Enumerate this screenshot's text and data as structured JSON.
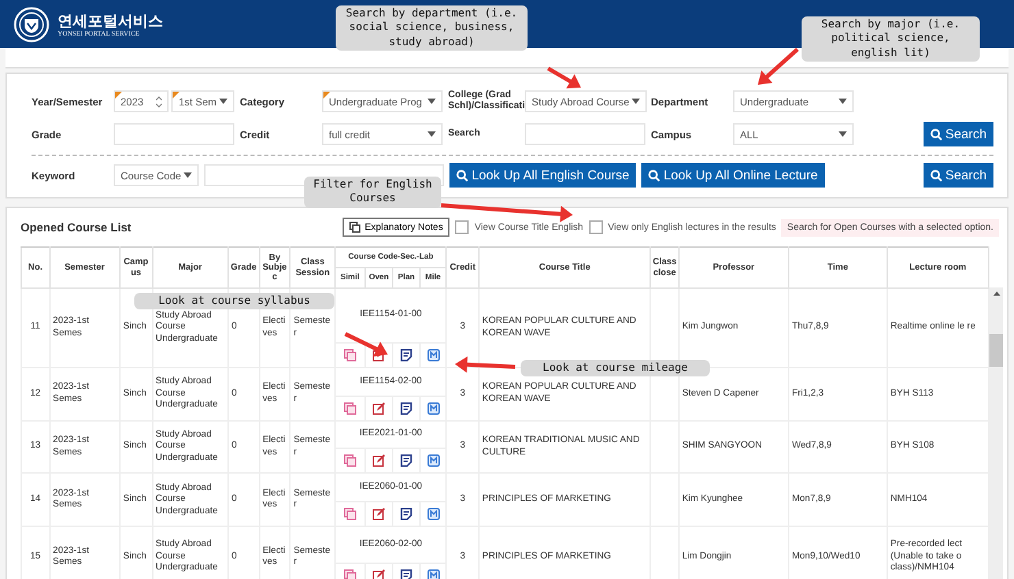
{
  "header": {
    "title": "연세포털서비스",
    "subtitle": "YONSEI PORTAL SERVICE"
  },
  "search_form": {
    "rows": [
      [
        {
          "label": "Year/Semester",
          "fields": [
            {
              "kind": "spinner",
              "value": "2023",
              "required": true
            },
            {
              "kind": "select",
              "value": "1st Sem",
              "required": true
            }
          ]
        },
        {
          "label": "Category",
          "fields": [
            {
              "kind": "select",
              "value": "Undergraduate Prog",
              "required": true
            }
          ]
        },
        {
          "label": "College (Grad Schl)/Classificati",
          "fields": [
            {
              "kind": "select",
              "value": "Study Abroad Course",
              "required": false
            }
          ]
        },
        {
          "label": "Department",
          "fields": [
            {
              "kind": "select",
              "value": "Undergraduate",
              "required": false
            }
          ]
        }
      ],
      [
        {
          "label": "Grade",
          "fields": [
            {
              "kind": "input"
            }
          ]
        },
        {
          "label": "Credit",
          "fields": [
            {
              "kind": "select",
              "value": "full credit",
              "required": false
            }
          ]
        },
        {
          "label": "Search",
          "fields": [
            {
              "kind": "input"
            }
          ]
        },
        {
          "label": "Campus",
          "fields": [
            {
              "kind": "select",
              "value": "ALL",
              "required": false
            }
          ]
        }
      ]
    ],
    "search_button": "Search",
    "keyword": {
      "label": "Keyword",
      "type_select": "Course Code"
    },
    "keyword_buttons": [
      "Look Up All English Course",
      "Look Up All Online Lecture",
      "Search"
    ]
  },
  "results": {
    "title": "Opened Course List",
    "notes_button": "Explanatory Notes",
    "options": [
      {
        "label": "View Course Title English",
        "checked": false
      },
      {
        "label": "View only English lectures in the results",
        "checked": false
      }
    ],
    "notice": "Search for Open Courses with a selected option.",
    "columns": [
      "No.",
      "Semester",
      "Campus",
      "Major",
      "Grade",
      "By Subjec",
      "Class Session",
      "Course Code-Sec.-Lab",
      "Credit",
      "Course Title",
      "Class close",
      "Professor",
      "Time",
      "Lecture room"
    ],
    "code_subcolumns": [
      "Simil",
      "Oven",
      "Plan",
      "Mile"
    ],
    "rows": [
      {
        "no": "11",
        "semester": "2023-1st Semes",
        "campus": "Sinch",
        "major": "Study Abroad Course Undergraduate",
        "grade": "0",
        "by_subject": "Electives",
        "session": "Semester",
        "code": "IEE1154-01-00",
        "credit": "3",
        "title": "KOREAN POPULAR CULTURE AND KOREAN WAVE",
        "professor": "Kim Jungwon",
        "time": "Thu7,8,9",
        "room": "Realtime online le re"
      },
      {
        "no": "12",
        "semester": "2023-1st Semes",
        "campus": "Sinch",
        "major": "Study Abroad Course Undergraduate",
        "grade": "0",
        "by_subject": "Electives",
        "session": "Semester",
        "code": "IEE1154-02-00",
        "credit": "3",
        "title": "KOREAN POPULAR CULTURE AND KOREAN WAVE",
        "professor": "Steven D  Capener",
        "time": "Fri1,2,3",
        "room": "BYH S113"
      },
      {
        "no": "13",
        "semester": "2023-1st Semes",
        "campus": "Sinch",
        "major": "Study Abroad Course Undergraduate",
        "grade": "0",
        "by_subject": "Electives",
        "session": "Semester",
        "code": "IEE2021-01-00",
        "credit": "3",
        "title": "KOREAN TRADITIONAL MUSIC AND CULTURE",
        "professor": "SHIM SANGYOON",
        "time": "Wed7,8,9",
        "room": "BYH S108"
      },
      {
        "no": "14",
        "semester": "2023-1st Semes",
        "campus": "Sinch",
        "major": "Study Abroad Course Undergraduate",
        "grade": "0",
        "by_subject": "Electives",
        "session": "Semester",
        "code": "IEE2060-01-00",
        "credit": "3",
        "title": "PRINCIPLES OF MARKETING",
        "professor": "Kim Kyunghee",
        "time": "Mon7,8,9",
        "room": "NMH104"
      },
      {
        "no": "15",
        "semester": "2023-1st Semes",
        "campus": "Sinch",
        "major": "Study Abroad Course Undergraduate",
        "grade": "0",
        "by_subject": "Electives",
        "session": "Semester",
        "code": "IEE2060-02-00",
        "credit": "3",
        "title": "PRINCIPLES OF MARKETING",
        "professor": "Lim Dongjin",
        "time": "Mon9,10/Wed10",
        "room": "Pre-recorded lect (Unable to take o class)/NMH104"
      }
    ]
  },
  "annotations": [
    "Search by department (i.e. social science, business, study abroad)",
    "Search by major (i.e. political science, english lit)",
    "Filter for English Courses",
    "Look at course syllabus",
    "Look at course mileage"
  ]
}
